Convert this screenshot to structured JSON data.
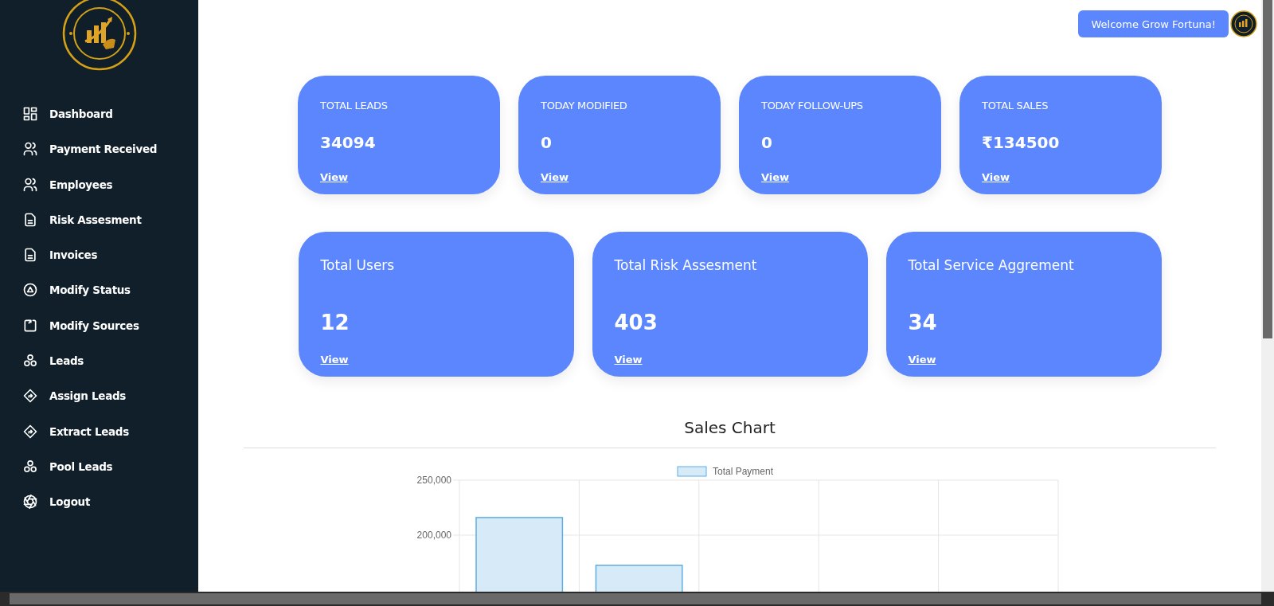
{
  "sidebar": {
    "items": [
      {
        "label": "Dashboard",
        "kind": "grid"
      },
      {
        "label": "Payment Received",
        "kind": "users"
      },
      {
        "label": "Employees",
        "kind": "users"
      },
      {
        "label": "Risk Assesment",
        "kind": "doc"
      },
      {
        "label": "Invoices",
        "kind": "doc"
      },
      {
        "label": "Modify Status",
        "kind": "triangle"
      },
      {
        "label": "Modify Sources",
        "kind": "box"
      },
      {
        "label": "Leads",
        "kind": "circles"
      },
      {
        "label": "Assign Leads",
        "kind": "diamond"
      },
      {
        "label": "Extract Leads",
        "kind": "diamond"
      },
      {
        "label": "Pool Leads",
        "kind": "circles"
      },
      {
        "label": "Logout",
        "kind": "aperture"
      }
    ]
  },
  "header": {
    "welcome": "Welcome Grow Fortuna!"
  },
  "stats_row_1": [
    {
      "title": "TOTAL LEADS",
      "value": "34094",
      "link": "View"
    },
    {
      "title": "TODAY MODIFIED",
      "value": "0",
      "link": "View"
    },
    {
      "title": "TODAY FOLLOW-UPS",
      "value": "0",
      "link": "View"
    },
    {
      "title": "TOTAL SALES",
      "value": "₹134500",
      "link": "View"
    }
  ],
  "stats_row_2": [
    {
      "title": "Total Users",
      "value": "12",
      "link": "View"
    },
    {
      "title": "Total Risk Assesment",
      "value": "403",
      "link": "View"
    },
    {
      "title": "Total Service Aggrement",
      "value": "34",
      "link": "View"
    }
  ],
  "sales_chart": {
    "heading": "Sales Chart",
    "chart_data": {
      "type": "bar",
      "series": [
        {
          "name": "Total Payment",
          "color": "#d6eaf8",
          "values": [
            216000,
            172500,
            null,
            null,
            null
          ]
        }
      ],
      "ylim": [
        0,
        250000
      ],
      "yticks": [
        {
          "value": 200000,
          "label": "200,000"
        },
        {
          "value": 250000,
          "label": "250,000"
        }
      ]
    }
  }
}
